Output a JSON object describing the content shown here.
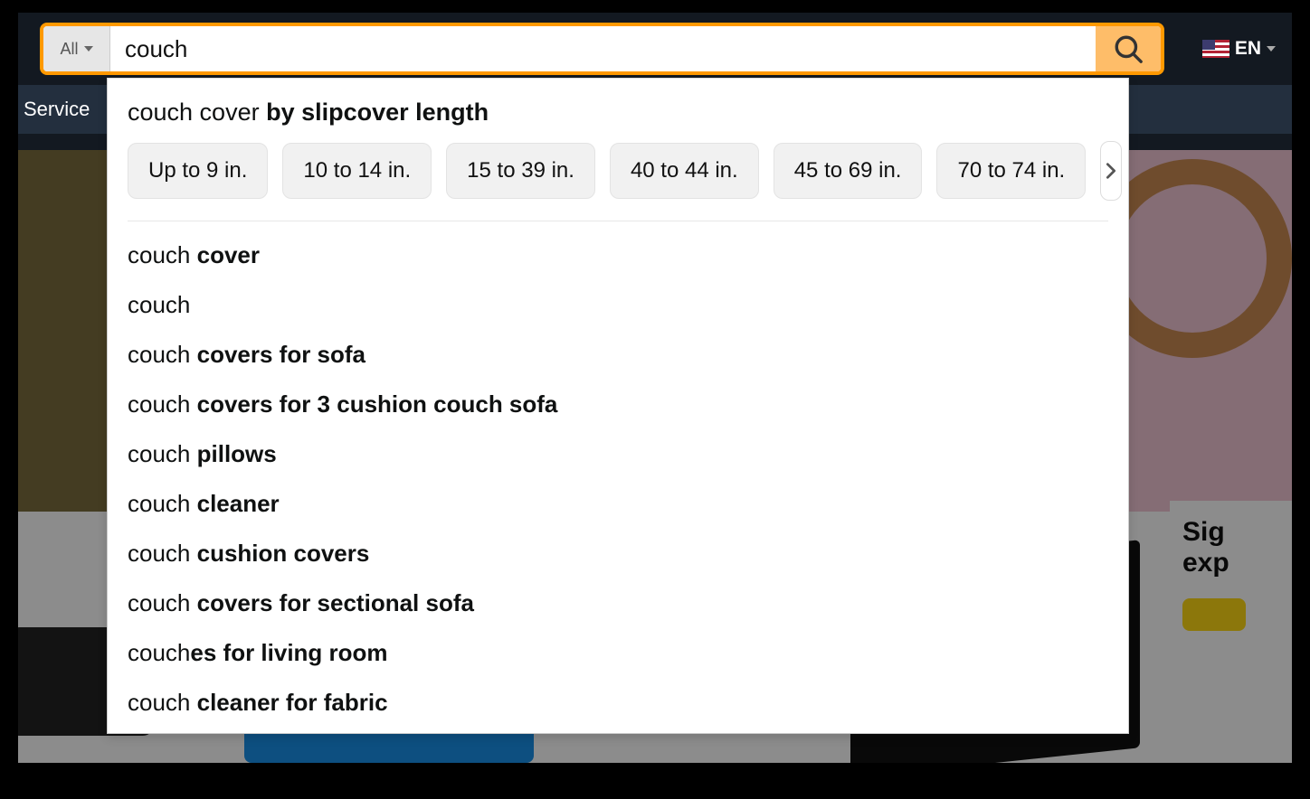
{
  "search": {
    "category": "All",
    "query": "couch"
  },
  "language": "EN",
  "subnav": {
    "service": "Service"
  },
  "promo": {
    "line1": "Sig",
    "line2": "exp"
  },
  "refine": {
    "prefix": "couch cover ",
    "bold": "by slipcover length",
    "chips": [
      "Up to 9 in.",
      "10 to 14 in.",
      "15 to 39 in.",
      "40 to 44 in.",
      "45 to 69 in.",
      "70 to 74 in."
    ]
  },
  "suggestions": [
    {
      "plain": "couch ",
      "bold": "cover"
    },
    {
      "plain": "couch",
      "bold": ""
    },
    {
      "plain": "couch ",
      "bold": "covers for sofa"
    },
    {
      "plain": "couch ",
      "bold": "covers for 3 cushion couch sofa"
    },
    {
      "plain": "couch ",
      "bold": "pillows"
    },
    {
      "plain": "couch ",
      "bold": "cleaner"
    },
    {
      "plain": "couch ",
      "bold": "cushion covers"
    },
    {
      "plain": "couch ",
      "bold": "covers for sectional sofa"
    },
    {
      "plain": "couch",
      "bold": "es for living room"
    },
    {
      "plain": "couch ",
      "bold": "cleaner for fabric"
    }
  ]
}
